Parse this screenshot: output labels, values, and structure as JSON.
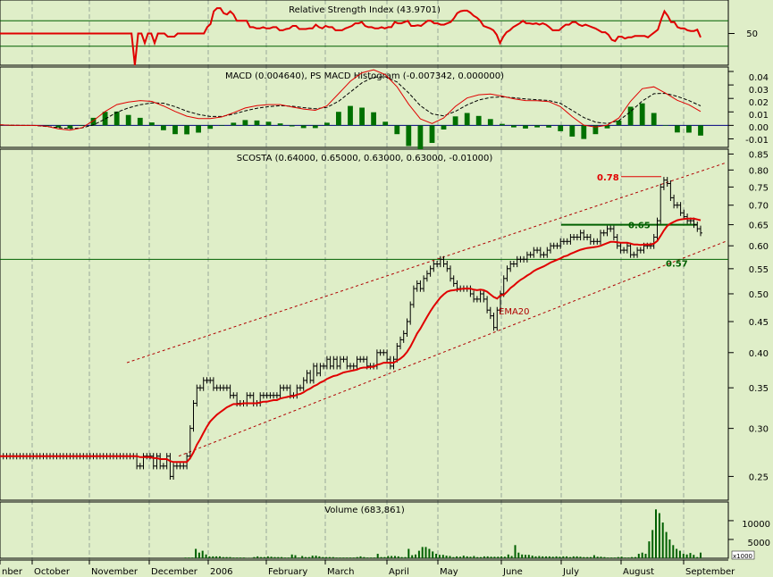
{
  "chart_data": {
    "type": "ohlc-stock-chart",
    "x_axis_labels": [
      "nber",
      "October",
      "November",
      "December",
      "2006",
      "February",
      "March",
      "April",
      "May",
      "June",
      "July",
      "August",
      "September"
    ],
    "panels": {
      "rsi": {
        "title": "Relative Strength Index (43.9701)",
        "ticks": [
          "50"
        ],
        "ylim": [
          0,
          100
        ],
        "reference_lines": [
          70,
          30
        ],
        "color": "#e00000",
        "values": [
          50,
          50,
          50,
          50,
          50,
          50,
          50,
          50,
          50,
          50,
          50,
          50,
          50,
          50,
          50,
          50,
          50,
          50,
          50,
          50,
          50,
          50,
          50,
          50,
          50,
          50,
          50,
          50,
          50,
          50,
          50,
          50,
          50,
          50,
          50,
          50,
          50,
          50,
          50,
          50,
          50,
          0,
          50,
          50,
          35,
          50,
          50,
          35,
          50,
          50,
          50,
          45,
          45,
          45,
          50,
          50,
          50,
          50,
          50,
          50,
          50,
          50,
          50,
          60,
          65,
          85,
          90,
          90,
          82,
          80,
          85,
          80,
          70,
          70,
          70,
          70,
          60,
          60,
          58,
          58,
          60,
          58,
          58,
          60,
          60,
          55,
          55,
          57,
          58,
          62,
          62,
          57,
          57,
          57,
          58,
          58,
          64,
          60,
          58,
          62,
          60,
          60,
          55,
          55,
          55,
          58,
          60,
          62,
          66,
          66,
          68,
          62,
          60,
          60,
          58,
          58,
          60,
          58,
          60,
          60,
          68,
          66,
          66,
          68,
          70,
          62,
          62,
          63,
          62,
          66,
          70,
          70,
          66,
          66,
          64,
          64,
          66,
          68,
          74,
          82,
          85,
          86,
          86,
          83,
          78,
          75,
          70,
          62,
          60,
          58,
          55,
          48,
          35,
          45,
          52,
          55,
          60,
          63,
          66,
          70,
          66,
          66,
          65,
          66,
          64,
          66,
          64,
          60,
          55,
          55,
          55,
          60,
          64,
          64,
          68,
          68,
          64,
          62,
          64,
          62,
          60,
          58,
          55,
          52,
          52,
          48,
          40,
          38,
          45,
          45,
          42,
          44,
          44,
          46,
          46,
          46,
          46,
          44,
          48,
          52,
          56,
          72,
          85,
          78,
          68,
          68,
          60,
          58,
          58,
          55,
          54,
          54,
          56,
          44
        ]
      },
      "macd": {
        "title": "MACD (0.004640), PS MACD Histogram (-0.007342, 0.000000)",
        "ticks": [
          "0.04",
          "0.03",
          "0.02",
          "0.01",
          "0.00",
          "-0.01"
        ],
        "ylim": [
          -0.015,
          0.042
        ],
        "line_color": "#e00000",
        "signal_color": "#000000",
        "histogram_color": "#007000",
        "macd": [
          0.0004,
          0.0001,
          0.0,
          0.0,
          -0.0007,
          -0.0026,
          -0.0036,
          -0.0019,
          0.0035,
          0.0103,
          0.0154,
          0.0173,
          0.0184,
          0.0178,
          0.0144,
          0.0103,
          0.0068,
          0.0051,
          0.0051,
          0.0063,
          0.0094,
          0.0129,
          0.0146,
          0.0154,
          0.0154,
          0.0137,
          0.0121,
          0.0112,
          0.0145,
          0.0235,
          0.0327,
          0.039,
          0.0412,
          0.0376,
          0.0286,
          0.0157,
          0.0048,
          0.0014,
          0.0055,
          0.0141,
          0.0203,
          0.0227,
          0.0233,
          0.0217,
          0.0197,
          0.0184,
          0.0183,
          0.0177,
          0.0139,
          0.0065,
          0.0002,
          -0.0012,
          0.0002,
          0.0055,
          0.0179,
          0.0272,
          0.0286,
          0.0239,
          0.0186,
          0.0153,
          0.0103
        ],
        "signal": [
          0.0004,
          0.0001,
          0.0,
          -0.0001,
          -0.0008,
          -0.0017,
          -0.0024,
          -0.0019,
          0.0003,
          0.0047,
          0.0097,
          0.013,
          0.0153,
          0.0167,
          0.0165,
          0.0139,
          0.0105,
          0.0081,
          0.0066,
          0.0066,
          0.0084,
          0.0108,
          0.0127,
          0.0139,
          0.0146,
          0.0142,
          0.0132,
          0.0123,
          0.0134,
          0.0179,
          0.0247,
          0.0316,
          0.0358,
          0.0361,
          0.0322,
          0.0241,
          0.0146,
          0.0085,
          0.0071,
          0.0104,
          0.0152,
          0.0188,
          0.0207,
          0.0211,
          0.0205,
          0.0196,
          0.019,
          0.0185,
          0.0163,
          0.0111,
          0.0058,
          0.0024,
          0.0014,
          0.0035,
          0.0102,
          0.0181,
          0.0235,
          0.0238,
          0.0215,
          0.0184,
          0.0145
        ],
        "histogram": [
          0.0001,
          0.0,
          0.0,
          0.0,
          -0.0,
          -0.0009,
          -0.0013,
          -0.0002,
          0.0031,
          0.0056,
          0.0057,
          0.0043,
          0.0031,
          0.0012,
          -0.002,
          -0.0036,
          -0.0037,
          -0.003,
          -0.0014,
          -0.0002,
          0.0011,
          0.0022,
          0.002,
          0.0015,
          0.0008,
          -0.0004,
          -0.0011,
          -0.0011,
          0.0011,
          0.0056,
          0.008,
          0.0073,
          0.0054,
          0.0015,
          -0.0036,
          -0.0085,
          -0.0098,
          -0.0072,
          -0.0017,
          0.0037,
          0.0051,
          0.0039,
          0.0026,
          0.0006,
          -0.0008,
          -0.0013,
          -0.0008,
          -0.0009,
          -0.0024,
          -0.0046,
          -0.0056,
          -0.0036,
          -0.0012,
          0.002,
          0.0077,
          0.0091,
          0.0051,
          0.0001,
          -0.0029,
          -0.003,
          -0.0042
        ]
      },
      "price": {
        "title": "SCOSTA (0.64000, 0.65000, 0.63000, 0.63000, -0.01000)",
        "ticks": [
          "0.85",
          "0.80",
          "0.75",
          "0.70",
          "0.65",
          "0.60",
          "0.55",
          "0.50",
          "0.45",
          "0.40",
          "0.35",
          "0.30",
          "0.25"
        ],
        "scale": "log",
        "ylim": [
          0.23,
          0.86
        ],
        "ema_label": "EMA20",
        "ema_color": "#e00000",
        "bar_color": "#000000",
        "close": [
          0.27,
          0.27,
          0.27,
          0.27,
          0.27,
          0.27,
          0.27,
          0.27,
          0.27,
          0.27,
          0.27,
          0.27,
          0.27,
          0.27,
          0.27,
          0.27,
          0.27,
          0.27,
          0.27,
          0.27,
          0.27,
          0.27,
          0.27,
          0.27,
          0.27,
          0.27,
          0.27,
          0.27,
          0.27,
          0.27,
          0.27,
          0.27,
          0.27,
          0.27,
          0.27,
          0.27,
          0.27,
          0.27,
          0.27,
          0.27,
          0.27,
          0.26,
          0.26,
          0.27,
          0.27,
          0.27,
          0.26,
          0.27,
          0.26,
          0.26,
          0.27,
          0.25,
          0.26,
          0.26,
          0.26,
          0.26,
          0.27,
          0.3,
          0.33,
          0.35,
          0.35,
          0.36,
          0.36,
          0.36,
          0.35,
          0.35,
          0.35,
          0.35,
          0.35,
          0.34,
          0.34,
          0.33,
          0.33,
          0.33,
          0.34,
          0.34,
          0.33,
          0.33,
          0.34,
          0.34,
          0.34,
          0.34,
          0.34,
          0.34,
          0.35,
          0.35,
          0.35,
          0.34,
          0.34,
          0.35,
          0.35,
          0.36,
          0.37,
          0.36,
          0.38,
          0.37,
          0.38,
          0.38,
          0.39,
          0.38,
          0.39,
          0.38,
          0.39,
          0.39,
          0.38,
          0.38,
          0.38,
          0.39,
          0.39,
          0.39,
          0.38,
          0.38,
          0.38,
          0.4,
          0.4,
          0.4,
          0.39,
          0.38,
          0.39,
          0.41,
          0.42,
          0.43,
          0.45,
          0.48,
          0.51,
          0.52,
          0.51,
          0.53,
          0.54,
          0.55,
          0.56,
          0.56,
          0.57,
          0.56,
          0.55,
          0.53,
          0.52,
          0.51,
          0.51,
          0.51,
          0.51,
          0.5,
          0.49,
          0.49,
          0.5,
          0.49,
          0.47,
          0.46,
          0.44,
          0.47,
          0.5,
          0.53,
          0.55,
          0.56,
          0.56,
          0.57,
          0.57,
          0.57,
          0.58,
          0.58,
          0.59,
          0.59,
          0.58,
          0.58,
          0.59,
          0.6,
          0.6,
          0.6,
          0.61,
          0.61,
          0.61,
          0.62,
          0.62,
          0.62,
          0.63,
          0.62,
          0.62,
          0.61,
          0.61,
          0.61,
          0.63,
          0.63,
          0.64,
          0.64,
          0.62,
          0.6,
          0.59,
          0.59,
          0.6,
          0.58,
          0.58,
          0.59,
          0.59,
          0.6,
          0.6,
          0.6,
          0.62,
          0.66,
          0.75,
          0.77,
          0.76,
          0.72,
          0.7,
          0.7,
          0.68,
          0.67,
          0.66,
          0.66,
          0.65,
          0.64,
          0.63
        ],
        "ema20": [
          0.27,
          0.27,
          0.27,
          0.27,
          0.27,
          0.27,
          0.27,
          0.27,
          0.27,
          0.27,
          0.27,
          0.27,
          0.27,
          0.27,
          0.27,
          0.27,
          0.27,
          0.27,
          0.27,
          0.27,
          0.27,
          0.27,
          0.27,
          0.27,
          0.27,
          0.27,
          0.27,
          0.27,
          0.27,
          0.27,
          0.27,
          0.27,
          0.27,
          0.27,
          0.27,
          0.27,
          0.27,
          0.27,
          0.27,
          0.27,
          0.27,
          0.27,
          0.269,
          0.269,
          0.269,
          0.269,
          0.268,
          0.268,
          0.267,
          0.267,
          0.267,
          0.265,
          0.264,
          0.264,
          0.264,
          0.264,
          0.264,
          0.268,
          0.274,
          0.282,
          0.288,
          0.295,
          0.302,
          0.308,
          0.312,
          0.316,
          0.319,
          0.322,
          0.325,
          0.327,
          0.329,
          0.329,
          0.329,
          0.33,
          0.33,
          0.33,
          0.33,
          0.33,
          0.331,
          0.332,
          0.332,
          0.333,
          0.334,
          0.334,
          0.336,
          0.337,
          0.338,
          0.339,
          0.339,
          0.341,
          0.342,
          0.344,
          0.347,
          0.349,
          0.352,
          0.354,
          0.357,
          0.359,
          0.362,
          0.364,
          0.366,
          0.367,
          0.369,
          0.371,
          0.372,
          0.373,
          0.374,
          0.375,
          0.377,
          0.378,
          0.378,
          0.379,
          0.379,
          0.382,
          0.383,
          0.385,
          0.385,
          0.385,
          0.385,
          0.388,
          0.391,
          0.395,
          0.401,
          0.409,
          0.419,
          0.43,
          0.438,
          0.448,
          0.458,
          0.468,
          0.477,
          0.485,
          0.493,
          0.499,
          0.504,
          0.506,
          0.507,
          0.508,
          0.509,
          0.51,
          0.51,
          0.51,
          0.508,
          0.507,
          0.508,
          0.507,
          0.504,
          0.499,
          0.494,
          0.491,
          0.497,
          0.498,
          0.504,
          0.511,
          0.516,
          0.522,
          0.527,
          0.531,
          0.536,
          0.54,
          0.545,
          0.549,
          0.552,
          0.555,
          0.559,
          0.563,
          0.566,
          0.569,
          0.572,
          0.576,
          0.578,
          0.582,
          0.585,
          0.588,
          0.591,
          0.593,
          0.595,
          0.596,
          0.597,
          0.598,
          0.6,
          0.603,
          0.606,
          0.609,
          0.609,
          0.608,
          0.607,
          0.607,
          0.607,
          0.605,
          0.603,
          0.603,
          0.602,
          0.603,
          0.603,
          0.603,
          0.605,
          0.611,
          0.623,
          0.636,
          0.647,
          0.653,
          0.657,
          0.661,
          0.663,
          0.664,
          0.665,
          0.665,
          0.665,
          0.663,
          0.661
        ],
        "annotations": [
          {
            "label": "0.78",
            "value": 0.78,
            "color": "#e00000",
            "line_color": "#e00000"
          },
          {
            "label": "0.65",
            "value": 0.65,
            "color": "#006000",
            "line_color": "#006000"
          },
          {
            "label": "0.57",
            "value": 0.57,
            "color": "#006000",
            "line_color": "#006000"
          }
        ],
        "channel": {
          "color": "#b00000",
          "upper": {
            "start": 0.385,
            "end": 0.822
          },
          "lower": {
            "start": 0.27,
            "end": 0.61
          }
        }
      },
      "volume": {
        "title": "Volume (683,861)",
        "ticks": [
          "10000",
          "5000"
        ],
        "scale_note": "x1000",
        "bar_color": "#006000",
        "values": [
          0,
          0,
          0,
          0,
          0,
          0,
          0,
          0,
          0,
          0,
          0,
          0,
          0,
          0,
          0,
          0,
          0,
          0,
          0,
          0,
          0,
          0,
          0,
          0,
          0,
          0,
          0,
          0,
          0,
          0,
          0,
          0,
          0,
          0,
          0,
          0,
          0,
          0,
          0,
          0,
          0,
          0,
          0,
          0,
          0,
          0,
          0,
          0,
          0,
          0,
          0,
          0,
          0,
          0,
          200,
          200,
          200,
          2500,
          1500,
          2000,
          1000,
          500,
          500,
          500,
          500,
          300,
          300,
          300,
          200,
          200,
          200,
          200,
          100,
          100,
          300,
          500,
          300,
          300,
          500,
          400,
          300,
          300,
          300,
          200,
          200,
          1000,
          800,
          200,
          600,
          300,
          300,
          700,
          700,
          500,
          300,
          300,
          300,
          300,
          200,
          200,
          200,
          200,
          200,
          200,
          300,
          500,
          300,
          200,
          200,
          200,
          1200,
          300,
          300,
          600,
          600,
          600,
          500,
          300,
          300,
          2500,
          800,
          1000,
          2000,
          3000,
          3000,
          2500,
          1800,
          1200,
          900,
          900,
          700,
          600,
          300,
          500,
          400,
          700,
          500,
          400,
          600,
          300,
          300,
          500,
          500,
          400,
          400,
          400,
          500,
          400,
          1000,
          600,
          3500,
          1500,
          1000,
          900,
          900,
          700,
          500,
          600,
          500,
          500,
          500,
          400,
          500,
          400,
          500,
          500,
          300,
          500,
          500,
          400,
          300,
          300,
          300,
          800,
          400,
          400,
          300,
          200,
          200,
          200,
          300,
          400,
          200,
          200,
          300,
          300,
          1200,
          1500,
          1200,
          4500,
          7500,
          13000,
          12000,
          9500,
          7000,
          5000,
          3500,
          2500,
          2000,
          1200,
          1000,
          1400,
          900,
          300,
          1500
        ]
      }
    }
  }
}
